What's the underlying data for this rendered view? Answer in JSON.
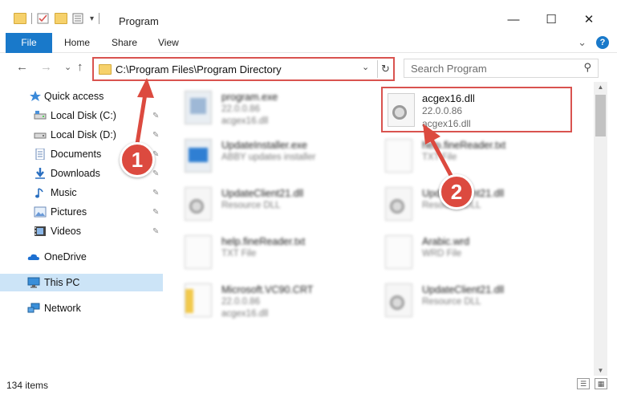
{
  "window": {
    "title": "Program",
    "minimize_glyph": "—",
    "maximize_glyph": "☐",
    "close_glyph": "✕"
  },
  "ribbon": {
    "file_label": "File",
    "tabs": [
      "Home",
      "Share",
      "View"
    ],
    "expand_glyph": "⌄",
    "help_glyph": "?"
  },
  "navigation": {
    "back_glyph": "←",
    "forward_glyph": "→",
    "recent_glyph": "⌄",
    "up_glyph": "↑",
    "address": "C:\\Program Files\\Program Directory",
    "address_dropdown_glyph": "⌄",
    "refresh_glyph": "↻",
    "search_placeholder": "Search Program",
    "search_glyph": "⚲"
  },
  "sidebar": {
    "items": [
      {
        "label": "Quick access",
        "icon": "star-icon",
        "pinned": false
      },
      {
        "label": "Local Disk (C:)",
        "icon": "drive-icon",
        "pinned": true
      },
      {
        "label": "Local Disk (D:)",
        "icon": "drive-icon",
        "pinned": true
      },
      {
        "label": "Documents",
        "icon": "documents-icon",
        "pinned": true
      },
      {
        "label": "Downloads",
        "icon": "downloads-icon",
        "pinned": true
      },
      {
        "label": "Music",
        "icon": "music-icon",
        "pinned": true
      },
      {
        "label": "Pictures",
        "icon": "pictures-icon",
        "pinned": true
      },
      {
        "label": "Videos",
        "icon": "videos-icon",
        "pinned": true
      },
      {
        "label": "OneDrive",
        "icon": "onedrive-icon",
        "pinned": false
      },
      {
        "label": "This PC",
        "icon": "this-pc-icon",
        "pinned": false,
        "selected": true
      },
      {
        "label": "Network",
        "icon": "network-icon",
        "pinned": false
      }
    ],
    "pin_glyph": "📌"
  },
  "files": [
    {
      "name": "program.exe",
      "line1": "22.0.0.86",
      "line2": "acgex16.dll",
      "icon": "exe-icon"
    },
    {
      "name": "acgex16.dll",
      "line1": "22.0.0.86",
      "line2": "acgex16.dll",
      "icon": "dll-icon",
      "highlighted": true
    },
    {
      "name": "UpdateInstaller.exe",
      "line1": "ABBY updates installer",
      "line2": "",
      "icon": "installer-icon"
    },
    {
      "name": "help.fineReader.txt",
      "line1": "TXT File",
      "line2": "",
      "icon": "text-file-icon"
    },
    {
      "name": "UpdateClient21.dll",
      "line1": "Resource DLL",
      "line2": "",
      "icon": "dll-icon"
    },
    {
      "name": "UpdateClient21.dll",
      "line1": "Resource DLL",
      "line2": "",
      "icon": "dll-icon"
    },
    {
      "name": "help.fineReader.txt",
      "line1": "TXT File",
      "line2": "",
      "icon": "text-file-icon"
    },
    {
      "name": "Arabic.wrd",
      "line1": "WRD File",
      "line2": "",
      "icon": "text-file-icon"
    },
    {
      "name": "Microsoft.VC90.CRT",
      "line1": "22.0.0.86",
      "line2": "acgex16.dll",
      "icon": "folder-file-icon"
    },
    {
      "name": "UpdateClient21.dll",
      "line1": "Resource DLL",
      "line2": "",
      "icon": "dll-icon"
    }
  ],
  "status": {
    "item_count": "134 items"
  },
  "annotations": {
    "step1": "1",
    "step2": "2",
    "color": "#dc4a3f"
  }
}
